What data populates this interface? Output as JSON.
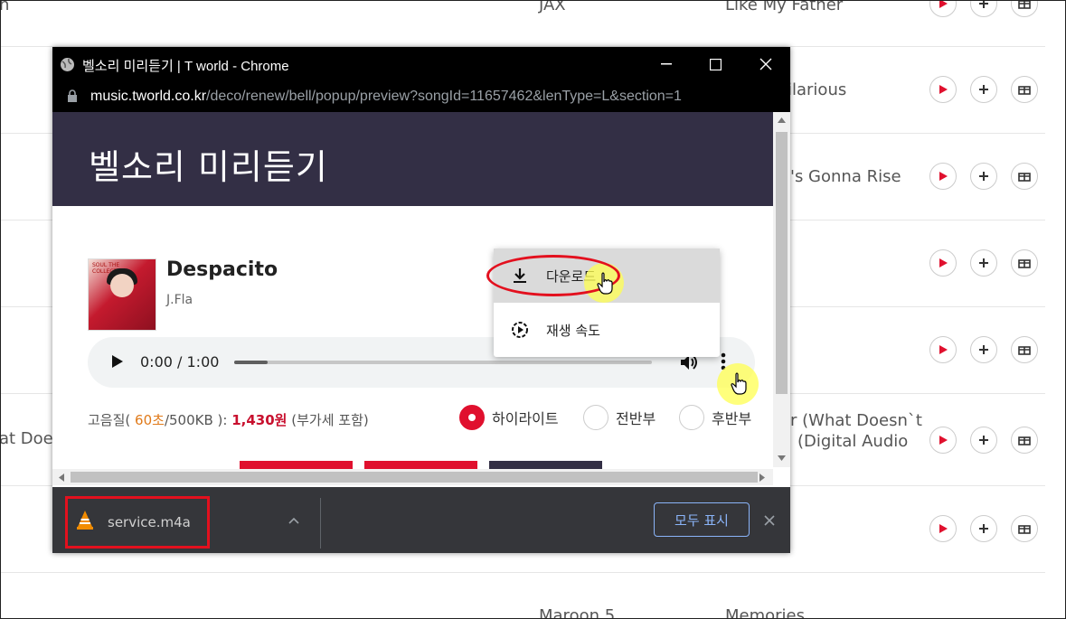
{
  "window": {
    "title": "벨소리 미리듣기 | T world - Chrome",
    "url_host": "music.tworld.co.kr",
    "url_path": "/deco/renew/bell/popup/preview?songId=11657462&lenType=L&section=1"
  },
  "page": {
    "header_title": "벨소리 미리듣기",
    "album_caption": "SOUL THE COLLECTION",
    "song_title": "Despacito",
    "artist": "J.Fla",
    "player": {
      "time": "0:00 / 1:00",
      "progress": 0.08
    },
    "quality": {
      "prefix": "고음질(",
      "seconds": "60초",
      "size": "/500KB ):",
      "price": "1,430원",
      "tax": "(부가세 포함)"
    },
    "options": [
      "하이라이트",
      "전반부",
      "후반부"
    ],
    "selected_option": "하이라이트"
  },
  "context_menu": {
    "items": [
      {
        "label": "다운로드",
        "icon": "download-icon"
      },
      {
        "label": "재생 속도",
        "icon": "playback-speed-icon"
      }
    ]
  },
  "download_bar": {
    "file_name": "service.m4a",
    "show_all": "모두 표시"
  },
  "background_list": {
    "artists": [
      "JAX",
      "Maroon 5"
    ],
    "titles": [
      "Like My Father",
      "ilarious",
      "'s Gonna Rise",
      "r (What Doesn`t",
      "(Digital Audio",
      "Memories"
    ],
    "left_fragment": "at Doe",
    "left_top_fragment": "n"
  },
  "colors": {
    "accent_red": "#e0102e",
    "header_bg": "#332f45",
    "annotation_red": "#e3101e",
    "highlight_yellow": "#ffff50"
  }
}
